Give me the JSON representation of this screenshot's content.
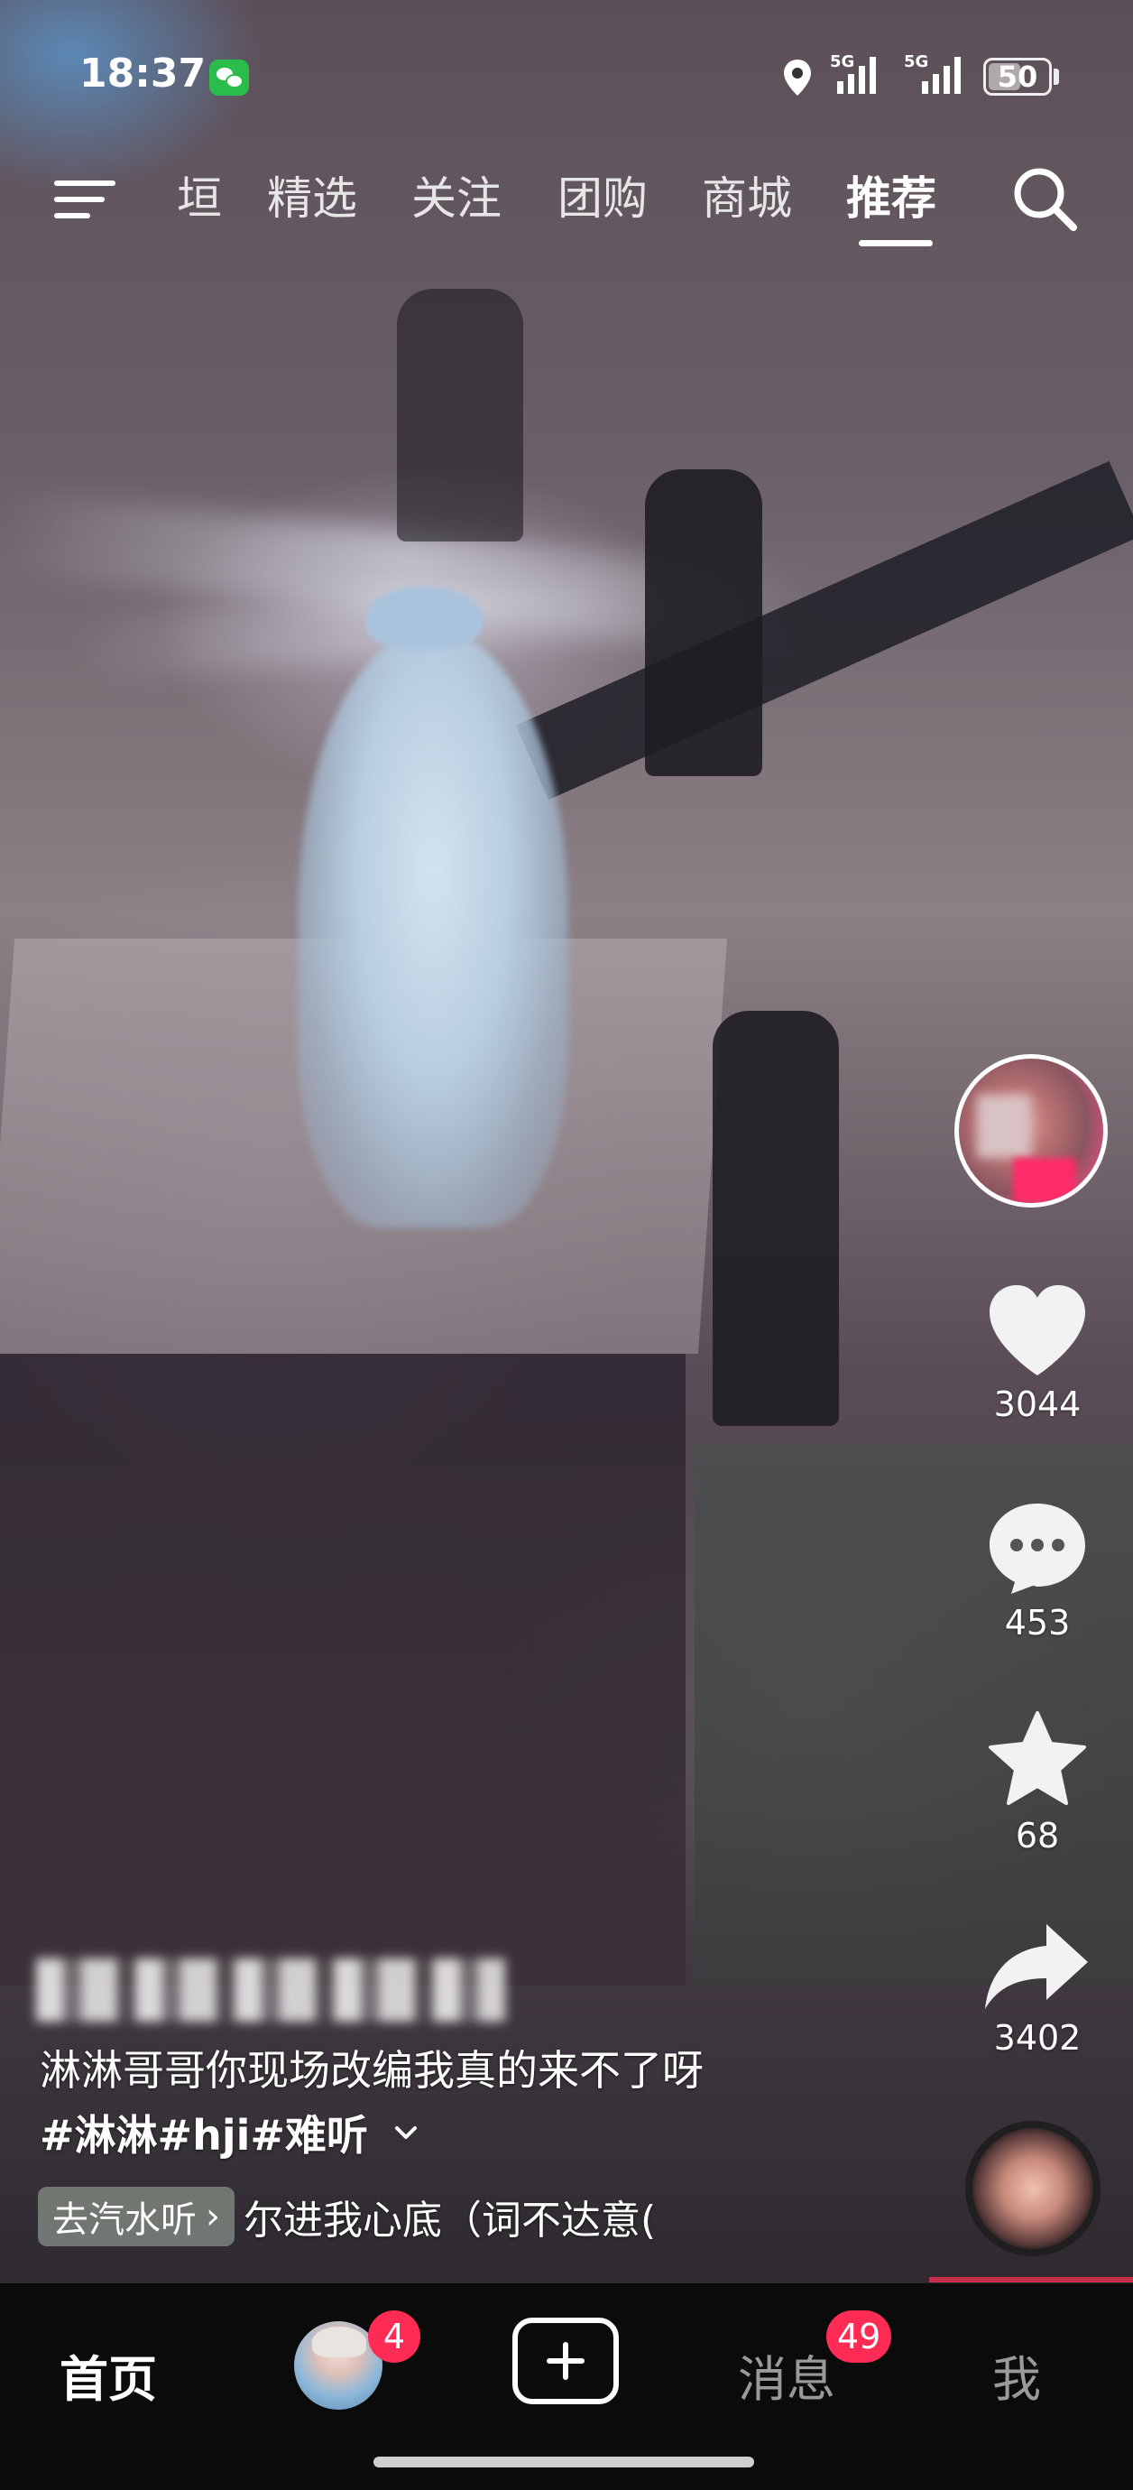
{
  "status_bar": {
    "time": "18:37",
    "network_1": "5G",
    "network_2": "5G",
    "battery": "50"
  },
  "top_nav": {
    "tabs": [
      {
        "label": "垣"
      },
      {
        "label": "精选"
      },
      {
        "label": "关注"
      },
      {
        "label": "团购"
      },
      {
        "label": "商城"
      },
      {
        "label": "推荐"
      }
    ],
    "active_tab": "推荐"
  },
  "actions": {
    "likes": "3044",
    "comments": "453",
    "favorites": "68",
    "shares": "3402"
  },
  "post": {
    "caption": "淋淋哥哥你现场改编我真的来不了呀",
    "hashtags": "#淋淋#hji#难听",
    "music_button": "去汽水听",
    "music_lyric": "尔进我心底（词不达意("
  },
  "bottom_nav": {
    "home": "首页",
    "friends_badge": "4",
    "messages": "消息",
    "messages_badge": "49",
    "me": "我"
  },
  "colors": {
    "accent": "#fe2c55",
    "nav_bg": "#0b0b0b",
    "wechat": "#2bbd4b"
  },
  "icons": {
    "menu": "menu-icon",
    "search": "search-icon",
    "like": "heart-icon",
    "comment": "comment-icon",
    "favorite": "star-icon",
    "share": "share-icon",
    "create": "plus-icon"
  }
}
